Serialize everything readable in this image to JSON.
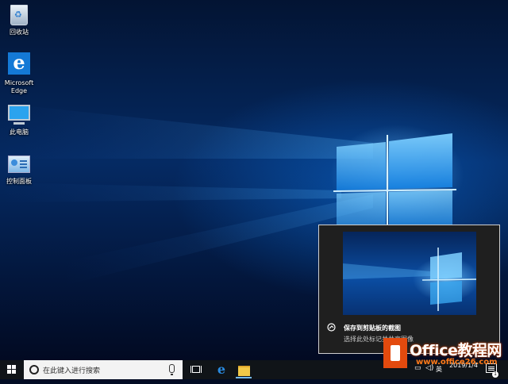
{
  "desktop": {
    "icons": [
      {
        "label": "回收站",
        "icon": "recycle-bin-icon"
      },
      {
        "label": "Microsoft\nEdge",
        "icon": "edge-icon"
      },
      {
        "label": "此电脑",
        "icon": "computer-icon"
      },
      {
        "label": "控制面板",
        "icon": "control-panel-icon"
      }
    ]
  },
  "snip_popup": {
    "title": "保存到剪贴板的截图",
    "subtitle": "选择此处标记并共享图像",
    "icon": "snip-sketch-icon"
  },
  "watermark": {
    "brand": "Office教程网",
    "url": "www.office26.com"
  },
  "taskbar": {
    "search_placeholder": "在此键入进行搜索",
    "tray": {
      "ime": "英",
      "clock_time": "",
      "clock_date": "2019/1/4",
      "notification_count": "1"
    }
  },
  "colors": {
    "taskbar": "#101418",
    "accent": "#0078d7",
    "watermark_orange": "#e34a0e"
  }
}
